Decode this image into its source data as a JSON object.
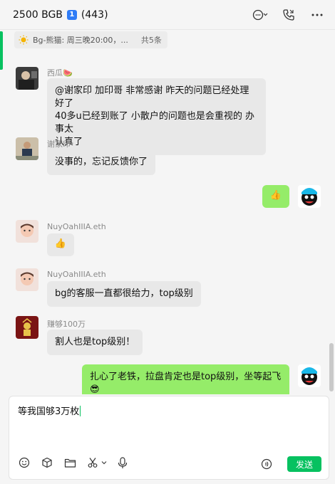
{
  "header": {
    "title": "2500 BGB",
    "badge": "1",
    "member_count": "(443)",
    "icons": [
      "chat-more-icon",
      "call-icon",
      "more-icon"
    ]
  },
  "pinned": {
    "text": "Bg-熊猫: 周三晚20:00，...",
    "total": "共5条",
    "icon": "sun-icon"
  },
  "messages": [
    {
      "sender": "西瓜🍉",
      "text_line1": "@谢家印 加印哥 非常感谢 昨天的问题已经处理好了",
      "text_line2": "40多u已经到账了 小散户的问题也是会重视的 办事太",
      "text_line3": "认真了",
      "direction": "in"
    },
    {
      "sender": "谢家印",
      "text": "没事的，忘记反馈你了",
      "direction": "in"
    },
    {
      "sender": "",
      "text": "👍",
      "direction": "out"
    },
    {
      "sender": "NuyOahIIIA.eth",
      "text": "👍",
      "direction": "in"
    },
    {
      "sender": "NuyOahIIIA.eth",
      "text": "bg的客服一直都很给力，top级别",
      "direction": "in"
    },
    {
      "sender": "赚够100万",
      "text": "割人也是top级别！",
      "direction": "in"
    },
    {
      "sender": "",
      "text": "扎心了老铁，拉盘肯定也是top级别，坐等起飞😎",
      "direction": "out"
    }
  ],
  "composer": {
    "value": "等我国够3万枚",
    "send_label": "发送",
    "tools": [
      "emoji-icon",
      "box-icon",
      "folder-icon",
      "scissors-icon",
      "microphone-icon",
      "voice-wave-icon"
    ]
  },
  "colors": {
    "accent": "#07c160",
    "bubble_out": "#95ec69",
    "bubble_in": "#e8e8e8",
    "badge": "#2f7cf6"
  }
}
